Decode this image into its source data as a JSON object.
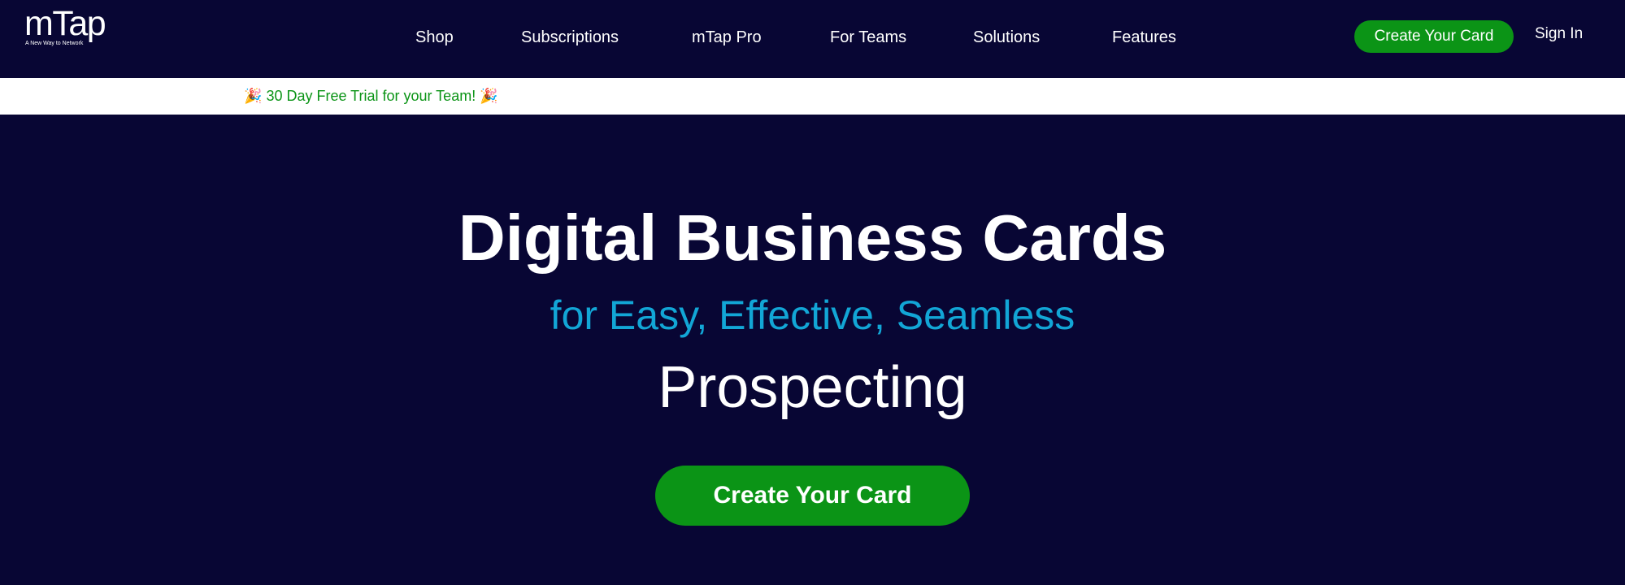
{
  "brand": {
    "logo_text": "mTap",
    "tagline": "A New Way to Network"
  },
  "nav": {
    "items": [
      {
        "label": "Shop"
      },
      {
        "label": "Subscriptions"
      },
      {
        "label": "mTap Pro"
      },
      {
        "label": "For Teams"
      },
      {
        "label": "Solutions"
      },
      {
        "label": "Features"
      }
    ],
    "cta_label": "Create Your Card",
    "signin_label": "Sign In"
  },
  "announcement": {
    "text": "30 Day Free Trial for your Team!",
    "icon": "party-popper-icon",
    "emoji": "🎉"
  },
  "hero": {
    "title": "Digital Business Cards",
    "subtitle": "for Easy, Effective, Seamless",
    "word": "Prospecting",
    "cta_label": "Create Your Card"
  },
  "colors": {
    "background": "#080634",
    "accent_green": "#0b9416",
    "accent_blue": "#12a6d6",
    "text": "#ffffff"
  }
}
